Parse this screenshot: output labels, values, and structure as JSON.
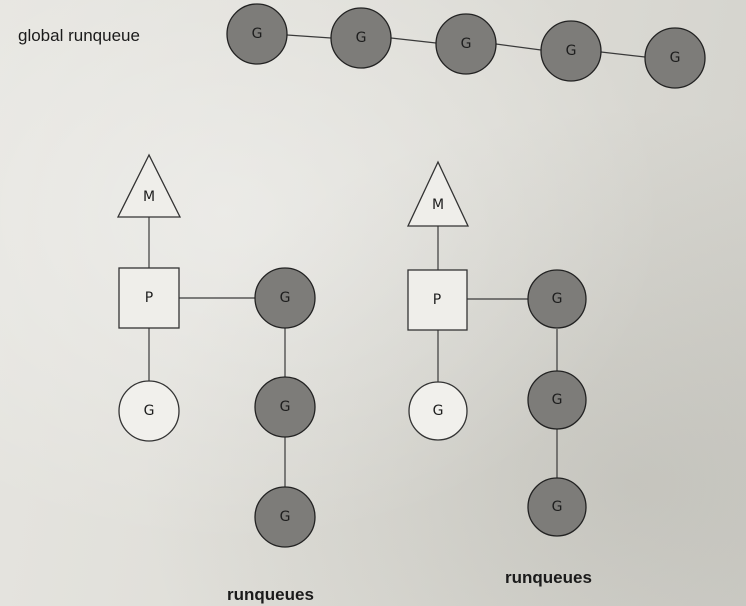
{
  "labels": {
    "global_runqueue": "global runqueue",
    "runqueues_left": "runqueues",
    "runqueues_right": "runqueues"
  },
  "node_letters": {
    "goroutine": "G",
    "processor": "P",
    "machine": "M"
  },
  "colors": {
    "queued_goroutine": "#7d7c79",
    "running_goroutine": "#f1f0ec",
    "outline": "#333333"
  },
  "global_runqueue": {
    "goroutines": [
      "G",
      "G",
      "G",
      "G",
      "G"
    ]
  },
  "processors": [
    {
      "machine": "M",
      "processor": "P",
      "running": "G",
      "local_runqueue": [
        "G",
        "G",
        "G"
      ]
    },
    {
      "machine": "M",
      "processor": "P",
      "running": "G",
      "local_runqueue": [
        "G",
        "G",
        "G"
      ]
    }
  ]
}
